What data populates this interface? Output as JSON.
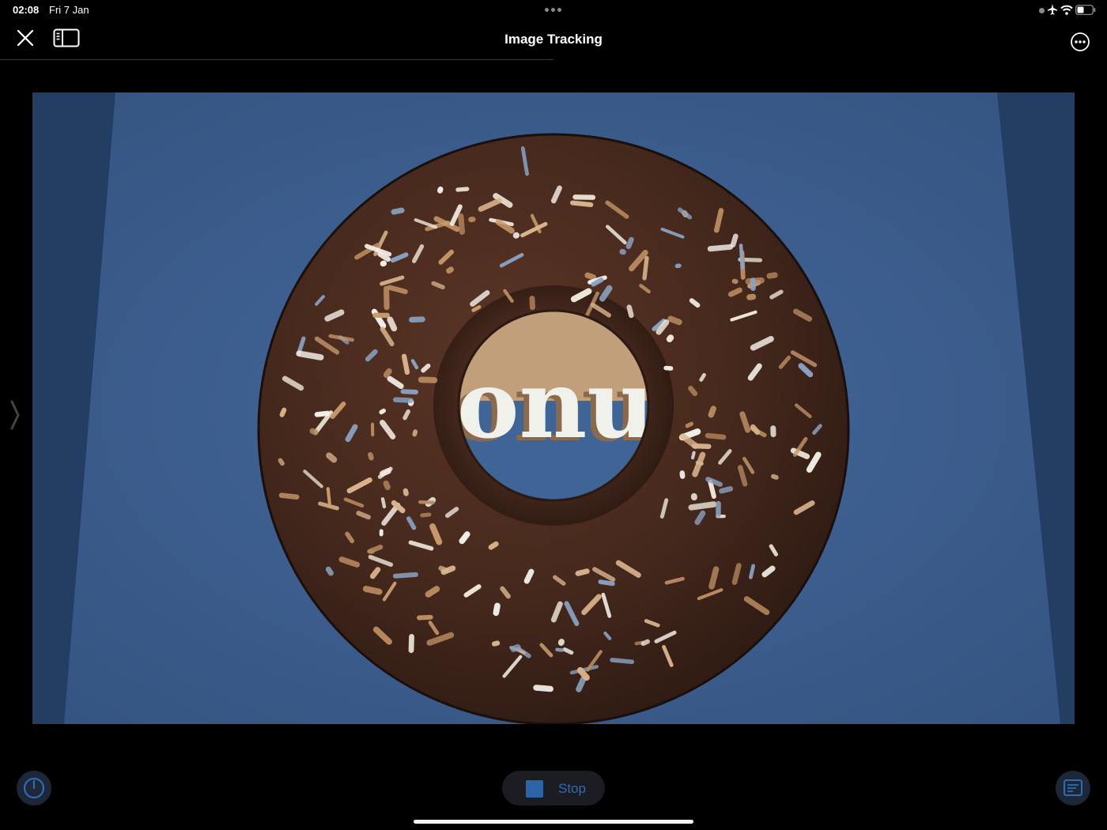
{
  "status_bar": {
    "time": "02:08",
    "date": "Fri 7 Jan"
  },
  "nav": {
    "title": "Image Tracking",
    "close_icon": "close-icon",
    "sidebar_icon": "sidebar-toggle-icon",
    "more_icon": "ellipsis-circle-icon"
  },
  "camera": {
    "surface_color": "#3c5f91",
    "donut_color": "#472a1e",
    "center_text": "onu"
  },
  "controls": {
    "stop_label": "Stop",
    "accent_color": "#2f6bb4"
  }
}
